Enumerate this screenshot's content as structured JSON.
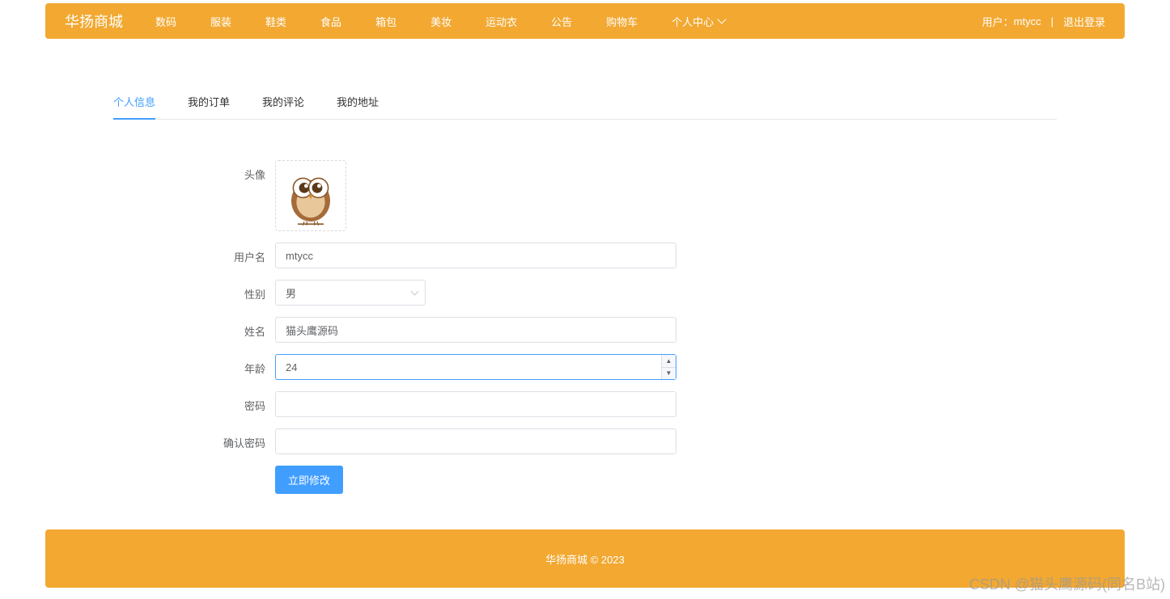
{
  "header": {
    "brand": "华扬商城",
    "nav": [
      "数码",
      "服装",
      "鞋类",
      "食品",
      "箱包",
      "美妆",
      "运动衣",
      "公告",
      "购物车",
      "个人中心"
    ],
    "user_prefix": "用户：",
    "username": "mtycc",
    "logout": "退出登录"
  },
  "tabs": {
    "items": [
      "个人信息",
      "我的订单",
      "我的评论",
      "我的地址"
    ],
    "active_index": 0
  },
  "form": {
    "avatar_label": "头像",
    "username_label": "用户名",
    "username_value": "mtycc",
    "gender_label": "性别",
    "gender_value": "男",
    "realname_label": "姓名",
    "realname_value": "猫头鹰源码",
    "age_label": "年龄",
    "age_value": "24",
    "password_label": "密码",
    "password_value": "",
    "confirm_password_label": "确认密码",
    "confirm_password_value": "",
    "submit_label": "立即修改"
  },
  "footer": {
    "text": "华扬商城 © 2023"
  },
  "watermark": "CSDN @猫头鹰源码(同名B站)"
}
